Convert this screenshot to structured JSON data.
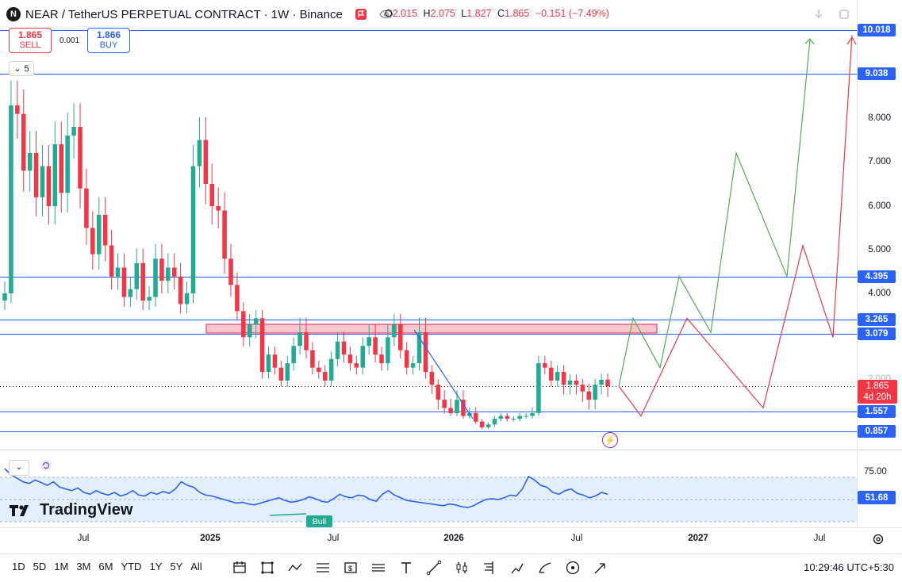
{
  "header": {
    "symbol": "NEAR / TetherUS PERPETUAL CONTRACT · 1W · Binance",
    "logo_text": "N",
    "ohlc": [
      {
        "k": "O",
        "v": "2.015"
      },
      {
        "k": "H",
        "v": "2.075"
      },
      {
        "k": "L",
        "v": "1.827"
      },
      {
        "k": "C",
        "v": "1.865"
      },
      {
        "k": "",
        "v": "−0.151 (−7.49%)"
      }
    ]
  },
  "trade": {
    "sell_price": "1.865",
    "sell_label": "SELL",
    "spread": "0.001",
    "buy_price": "1.866",
    "buy_label": "BUY"
  },
  "indicators_collapse": {
    "count": "5"
  },
  "price_axis": {
    "ticks": [
      "8.000",
      "7.000",
      "6.000",
      "5.000",
      "4.000",
      "2.000"
    ],
    "levels": [
      "10.018",
      "9.038",
      "4.395",
      "3.265",
      "3.079",
      "1.557",
      "0.857"
    ],
    "current_price": "1.865",
    "countdown": "4d 20h"
  },
  "time_axis": [
    {
      "label": "Jul",
      "bold": false
    },
    {
      "label": "2025",
      "bold": true
    },
    {
      "label": "Jul",
      "bold": false
    },
    {
      "label": "2026",
      "bold": true
    },
    {
      "label": "Jul",
      "bold": false
    },
    {
      "label": "2027",
      "bold": true
    },
    {
      "label": "Jul",
      "bold": false
    }
  ],
  "rsi": {
    "level_label": "75.00",
    "value": "51.68",
    "signal_label": "Bull"
  },
  "brand": {
    "name": "TradingView"
  },
  "bottom_bar": {
    "timeframes": [
      "1D",
      "5D",
      "1M",
      "3M",
      "6M",
      "YTD",
      "1Y",
      "5Y",
      "All"
    ],
    "clock": "10:29:46 UTC+5:30"
  },
  "colors": {
    "up": "#22ab94",
    "down": "#f23645",
    "line_blue": "#2962ff",
    "zone_fill": "#f8c7cd",
    "rsi_band": "#e3effd",
    "proj_green": "#4caf50",
    "proj_red": "#f23645"
  },
  "chart_data": {
    "type": "candlestick",
    "symbol": "NEAR / TetherUS PERPETUAL CONTRACT",
    "interval": "1W",
    "exchange": "Binance",
    "x_ticks": [
      "Jul",
      "2025",
      "Jul",
      "2026",
      "Jul",
      "2027",
      "Jul"
    ],
    "y_ticks": [
      8.0,
      7.0,
      6.0,
      5.0,
      4.0,
      2.0
    ],
    "horizontal_levels": [
      10.018,
      9.038,
      4.395,
      3.265,
      3.079,
      1.557,
      0.857
    ],
    "last": {
      "open": 2.015,
      "high": 2.075,
      "low": 1.827,
      "close": 1.865,
      "change": -0.151,
      "change_pct": -7.49
    },
    "supply_zone": [
      3.079,
      3.265
    ],
    "closes": [
      4.0,
      8.3,
      8.1,
      6.8,
      7.2,
      6.2,
      6.9,
      6.0,
      7.4,
      6.3,
      7.6,
      7.8,
      6.4,
      5.5,
      4.9,
      5.8,
      5.1,
      4.4,
      4.6,
      3.9,
      4.1,
      4.7,
      3.8,
      3.9,
      4.8,
      4.3,
      4.6,
      4.4,
      3.7,
      4.0,
      6.9,
      7.5,
      6.5,
      6.0,
      5.9,
      4.8,
      4.2,
      3.5,
      3.0,
      3.2,
      3.3,
      2.2,
      2.6,
      2.3,
      2.0,
      2.4,
      2.8,
      3.1,
      2.7,
      2.3,
      2.2,
      2.0,
      2.5,
      2.9,
      2.6,
      2.4,
      2.3,
      2.8,
      3.0,
      2.6,
      2.4,
      3.0,
      3.2,
      2.7,
      2.3,
      2.4,
      3.1,
      2.2,
      1.9,
      1.7,
      1.6,
      1.5,
      1.7,
      1.4,
      1.5,
      1.2,
      1.0,
      1.1,
      1.3,
      1.4,
      1.3,
      1.3,
      1.4,
      1.4,
      1.5,
      2.4,
      2.3,
      2.0,
      2.2,
      1.9,
      2.0,
      1.9,
      1.8,
      1.7,
      1.9,
      2.02,
      1.865
    ],
    "projections": [
      {
        "name": "",
        "color": "green",
        "path": [
          1.865,
          3.3,
          2.3,
          4.4,
          3.1,
          7.2,
          4.4,
          9.8
        ]
      },
      {
        "name": "",
        "color": "red",
        "path": [
          1.865,
          1.4,
          3.3,
          1.6,
          5.1,
          3.0,
          9.9
        ]
      }
    ],
    "rsi": {
      "upper": 75.0,
      "last": 51.68
    }
  }
}
